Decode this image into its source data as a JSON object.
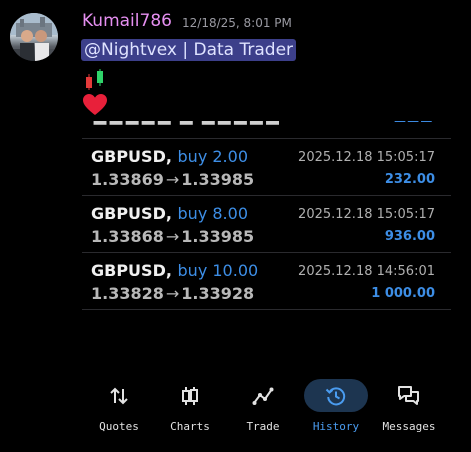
{
  "message": {
    "username": "Kumail786",
    "timestamp": "12/18/25, 8:01 PM",
    "mention": "@Nightvex | Data Trader",
    "emojis": [
      "candlestick-icon",
      "red-heart-icon"
    ]
  },
  "colors": {
    "username": "#e58ff0",
    "mention_bg": "#3c3f8a",
    "accent_blue": "#3d8ee6",
    "active_tab_bg": "#1d3550"
  },
  "history": {
    "rows": [
      {
        "pair": "GBPUSD,",
        "side": "buy 2.00",
        "open_price": "1.33869",
        "arrow": "→",
        "close_price": "1.33985",
        "datetime": "2025.12.18 15:05:17",
        "profit": "232.00"
      },
      {
        "pair": "GBPUSD,",
        "side": "buy 8.00",
        "open_price": "1.33868",
        "arrow": "→",
        "close_price": "1.33985",
        "datetime": "2025.12.18 15:05:17",
        "profit": "936.00"
      },
      {
        "pair": "GBPUSD,",
        "side": "buy 10.00",
        "open_price": "1.33828",
        "arrow": "→",
        "close_price": "1.33928",
        "datetime": "2025.12.18 14:56:01",
        "profit": "1 000.00"
      }
    ]
  },
  "tabs": [
    {
      "label": "Quotes",
      "icon": "quotes-arrows-icon",
      "active": false
    },
    {
      "label": "Charts",
      "icon": "candles-icon",
      "active": false
    },
    {
      "label": "Trade",
      "icon": "trade-line-icon",
      "active": false
    },
    {
      "label": "History",
      "icon": "history-clock-icon",
      "active": true
    },
    {
      "label": "Messages",
      "icon": "messages-icon",
      "active": false
    }
  ]
}
